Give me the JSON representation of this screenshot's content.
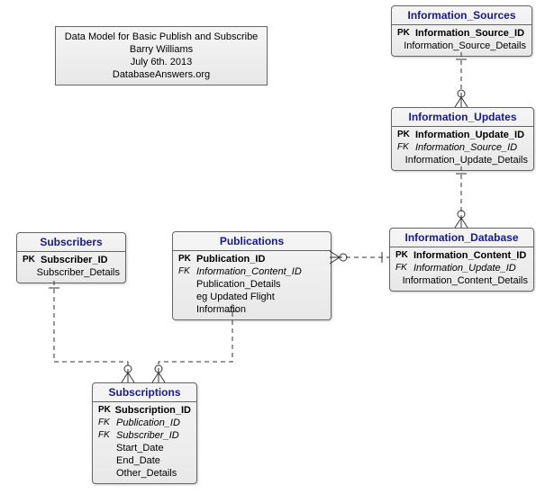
{
  "infobox": {
    "line1": "Data Model for Basic Publish and Subscribe",
    "line2": "Barry Williams",
    "line3": "July 6th. 2013",
    "line4": "DatabaseAnswers.org"
  },
  "entities": {
    "info_sources": {
      "title": "Information_Sources",
      "attrs": [
        {
          "key": "PK",
          "name": "Information_Source_ID",
          "pk": true
        },
        {
          "key": "",
          "name": "Information_Source_Details"
        }
      ]
    },
    "info_updates": {
      "title": "Information_Updates",
      "attrs": [
        {
          "key": "PK",
          "name": "Information_Update_ID",
          "pk": true
        },
        {
          "key": "FK",
          "name": "Information_Source_ID",
          "fk": true
        },
        {
          "key": "",
          "name": "Information_Update_Details"
        }
      ]
    },
    "info_database": {
      "title": "Information_Database",
      "attrs": [
        {
          "key": "PK",
          "name": "Information_Content_ID",
          "pk": true
        },
        {
          "key": "FK",
          "name": "Information_Update_ID",
          "fk": true
        },
        {
          "key": "",
          "name": "Information_Content_Details"
        }
      ]
    },
    "publications": {
      "title": "Publications",
      "attrs": [
        {
          "key": "PK",
          "name": "Publication_ID",
          "pk": true
        },
        {
          "key": "FK",
          "name": "Information_Content_ID",
          "fk": true
        },
        {
          "key": "",
          "name": "Publication_Details"
        },
        {
          "key": "",
          "name": "eg Updated Flight Information"
        }
      ]
    },
    "subscribers": {
      "title": "Subscribers",
      "attrs": [
        {
          "key": "PK",
          "name": "Subscriber_ID",
          "pk": true
        },
        {
          "key": "",
          "name": "Subscriber_Details"
        }
      ]
    },
    "subscriptions": {
      "title": "Subscriptions",
      "attrs": [
        {
          "key": "PK",
          "name": "Subscription_ID",
          "pk": true
        },
        {
          "key": "FK",
          "name": "Publication_ID",
          "fk": true
        },
        {
          "key": "FK",
          "name": "Subscriber_ID",
          "fk": true
        },
        {
          "key": "",
          "name": "Start_Date"
        },
        {
          "key": "",
          "name": "End_Date"
        },
        {
          "key": "",
          "name": "Other_Details"
        }
      ]
    }
  }
}
